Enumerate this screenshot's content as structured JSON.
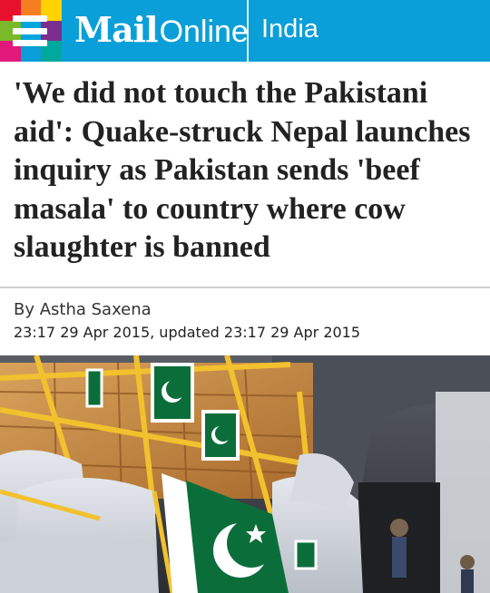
{
  "header": {
    "brand_mail": "Mail",
    "brand_online": "Online",
    "edition": "India",
    "menu_icon": "hamburger-menu-icon",
    "menu_tile_colors": [
      "#e8112d",
      "#f57e20",
      "#ffd200",
      "#7ab929",
      "#00a6e0",
      "#7b2e8e",
      "#e2187a",
      "#0a9fd8",
      "#00a99d"
    ]
  },
  "article": {
    "headline": "'We did not touch the Pakistani aid': Quake-struck Nepal launches inquiry as Pakistan sends 'beef masala' to country where cow slaughter is banned",
    "byline": "By Astha Saxena",
    "timestamp": "23:17 29 Apr 2015, updated 23:17 29 Apr 2015",
    "photo": "Relief aid sacks bearing Pakistani flags loaded on a cargo aircraft"
  },
  "colors": {
    "header_bg": "#0a9fd8",
    "headline": "#222222",
    "flag_green": "#0b6e3a"
  }
}
